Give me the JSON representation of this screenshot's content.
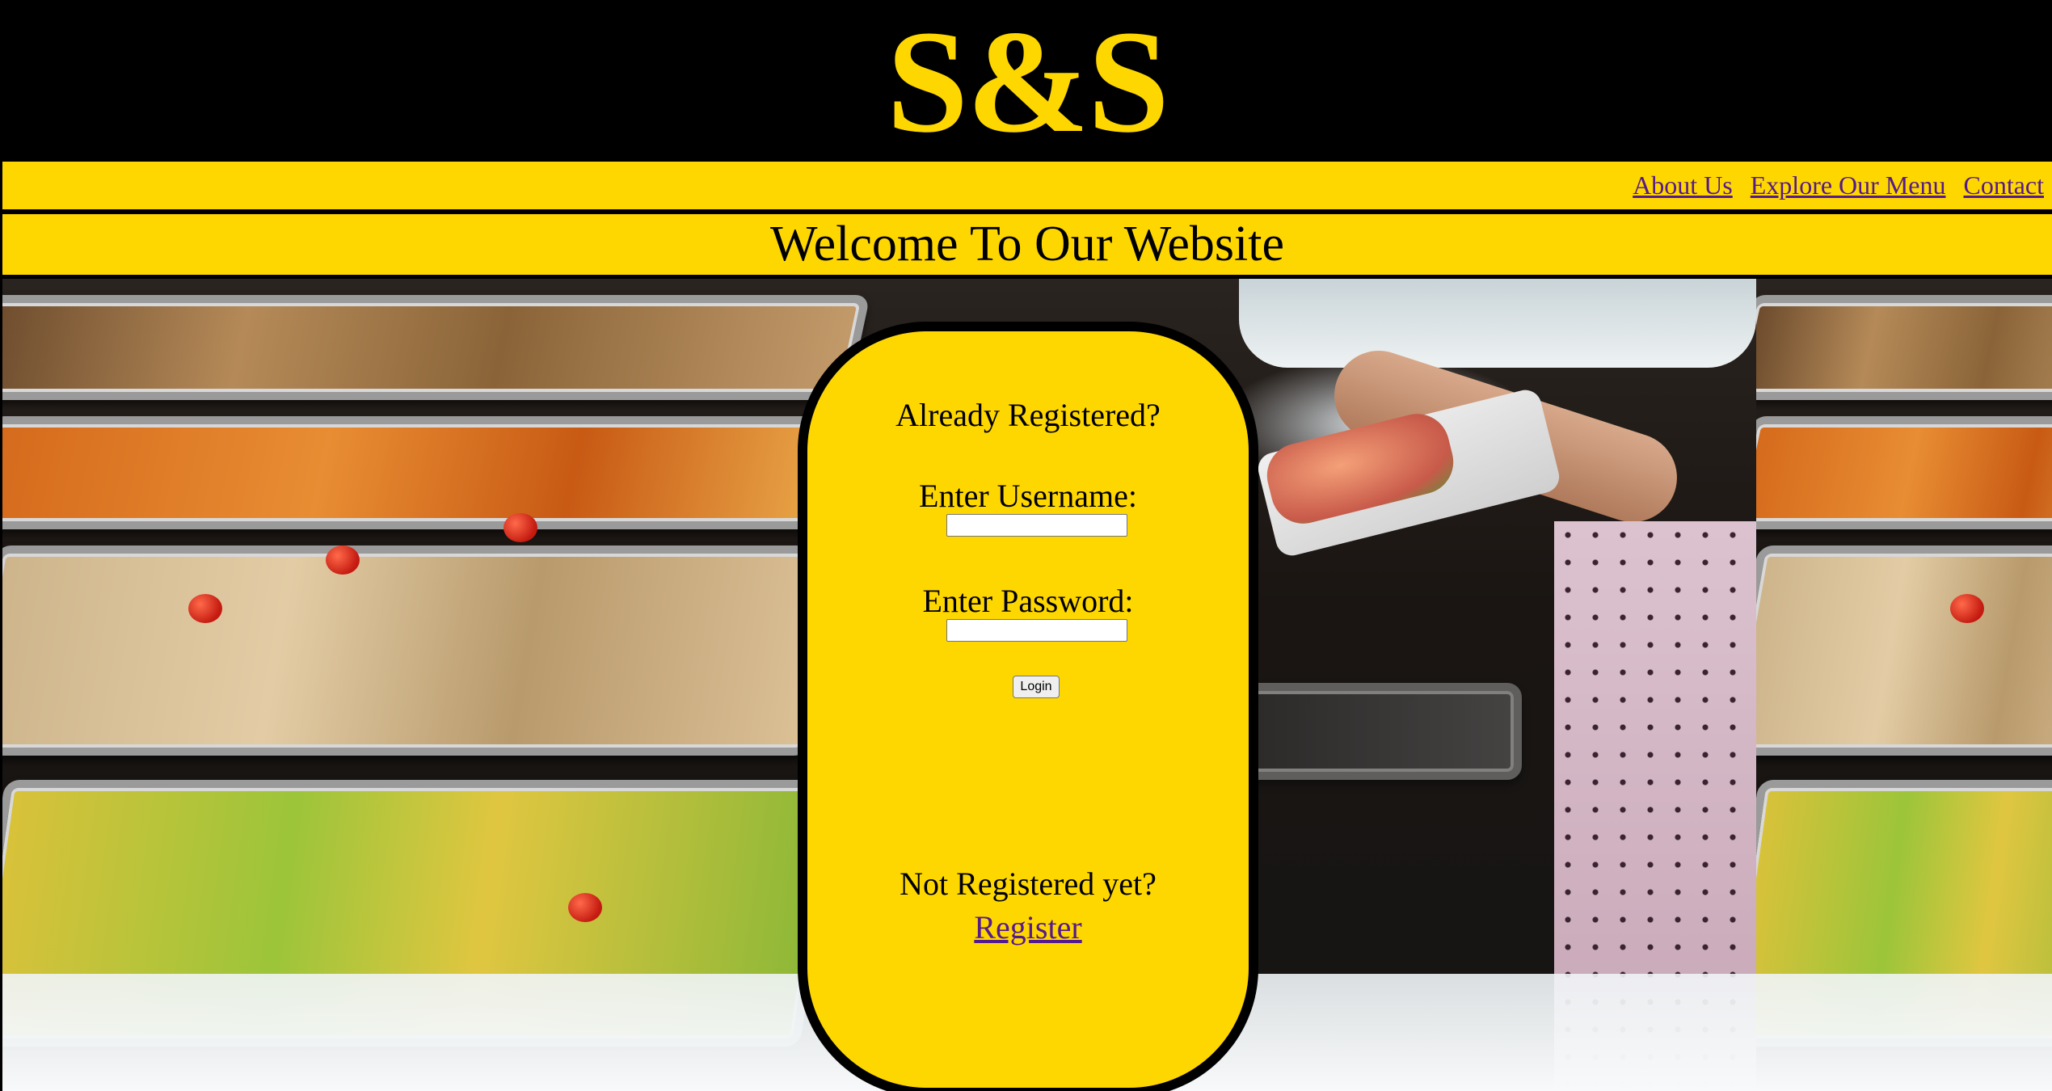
{
  "header": {
    "logo_text": "S&S"
  },
  "nav": {
    "items": [
      {
        "label": "About Us"
      },
      {
        "label": "Explore Our Menu"
      },
      {
        "label": "Contact"
      }
    ]
  },
  "welcome": {
    "title": "Welcome To Our Website"
  },
  "login": {
    "already_registered": "Already Registered?",
    "username_label": "Enter Username:",
    "username_value": "",
    "password_label": "Enter Password:",
    "password_value": "",
    "login_button": "Login",
    "not_registered": "Not Registered yet?",
    "register_link": "Register"
  },
  "colors": {
    "accent_yellow": "#FFD700",
    "header_black": "#000000",
    "link_visited": "#551A8B"
  },
  "background": {
    "image_semantic": "buffet-catering-trays-photo"
  }
}
